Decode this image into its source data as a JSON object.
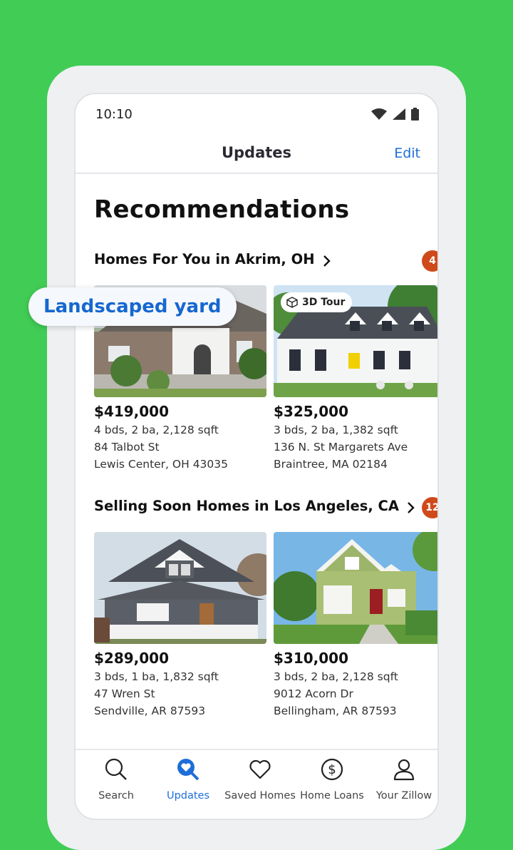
{
  "status": {
    "time": "10:10"
  },
  "header": {
    "title": "Updates",
    "edit_label": "Edit"
  },
  "page_title": "Recommendations",
  "tooltip": "Landscaped yard",
  "sections": [
    {
      "title": "Homes For You in Akrim, OH",
      "count": "4",
      "cards": [
        {
          "price": "$419,000",
          "details": "4 bds, 2 ba, 2,128 sqft",
          "street": "84 Talbot St",
          "city": "Lewis Center, OH 43035",
          "badge": ""
        },
        {
          "price": "$325,000",
          "details": "3 bds, 2 ba, 1,382 sqft",
          "street": "136 N. St Margarets Ave",
          "city": "Braintree, MA 02184",
          "badge": "3D Tour"
        }
      ]
    },
    {
      "title": "Selling Soon Homes in Los Angeles, CA",
      "count": "12",
      "cards": [
        {
          "price": "$289,000",
          "details": "3 bds, 1 ba, 1,832 sqft",
          "street": "47 Wren St",
          "city": "Sendville, AR 87593",
          "badge": ""
        },
        {
          "price": "$310,000",
          "details": "3 bds, 2 ba, 2,128 sqft",
          "street": "9012 Acorn Dr",
          "city": "Bellingham, AR 87593",
          "badge": ""
        }
      ]
    }
  ],
  "nav": [
    {
      "label": "Search",
      "icon": "search-icon"
    },
    {
      "label": "Updates",
      "icon": "updates-icon",
      "active": true
    },
    {
      "label": "Saved Homes",
      "icon": "heart-icon"
    },
    {
      "label": "Home Loans",
      "icon": "dollar-icon"
    },
    {
      "label": "Your Zillow",
      "icon": "user-icon"
    }
  ],
  "colors": {
    "background": "#41cc55",
    "accent": "#1d6ed8",
    "badge": "#cf4a1b"
  }
}
